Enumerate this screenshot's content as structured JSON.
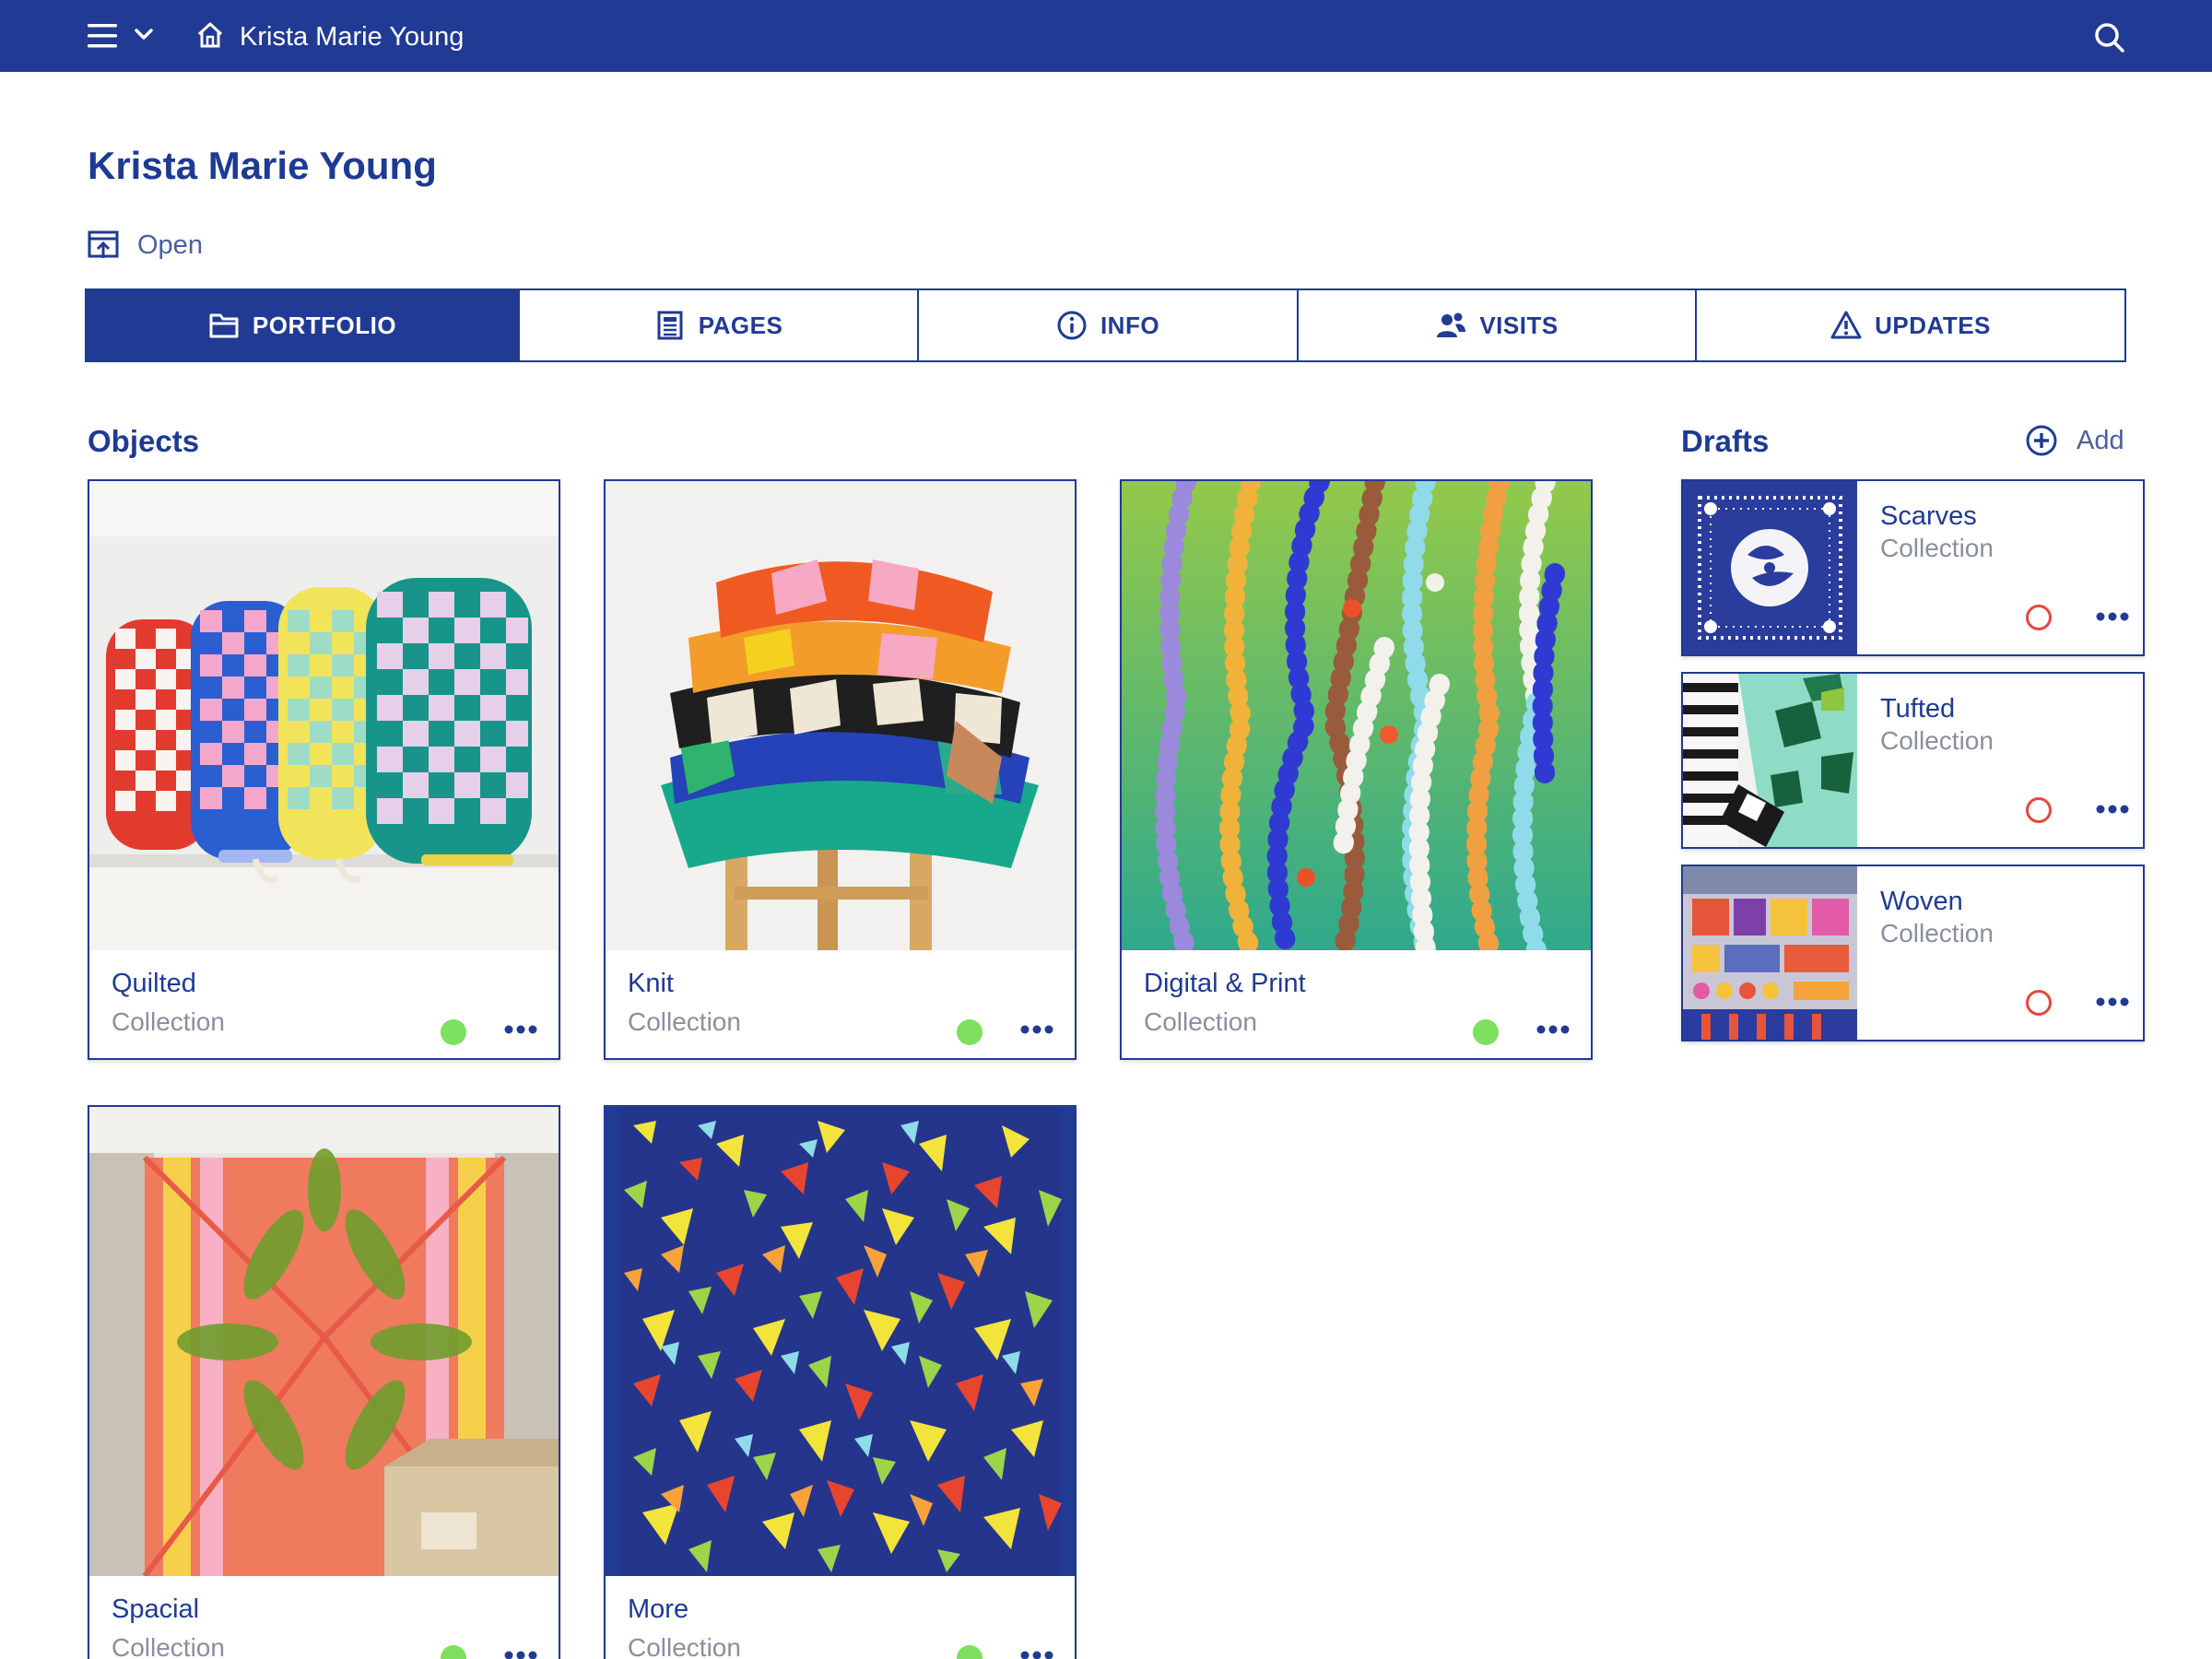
{
  "topbar": {
    "breadcrumb": "Krista Marie Young",
    "icons": [
      "menu-icon",
      "chevron-down-icon",
      "home-icon",
      "search-icon"
    ]
  },
  "header": {
    "title": "Krista Marie Young",
    "open_label": "Open"
  },
  "tabs": [
    {
      "label": "PORTFOLIO",
      "icon": "folder-icon",
      "active": true
    },
    {
      "label": "PAGES",
      "icon": "document-icon",
      "active": false
    },
    {
      "label": "INFO",
      "icon": "info-icon",
      "active": false
    },
    {
      "label": "VISITS",
      "icon": "users-icon",
      "active": false
    },
    {
      "label": "UPDATES",
      "icon": "warning-icon",
      "active": false
    }
  ],
  "objects": {
    "title": "Objects",
    "items": [
      {
        "name": "Quilted",
        "type": "Collection",
        "status": "published"
      },
      {
        "name": "Knit",
        "type": "Collection",
        "status": "published"
      },
      {
        "name": "Digital & Print",
        "type": "Collection",
        "status": "published"
      },
      {
        "name": "Spacial",
        "type": "Collection",
        "status": "published"
      },
      {
        "name": "More",
        "type": "Collection",
        "status": "published"
      }
    ]
  },
  "drafts": {
    "title": "Drafts",
    "add_label": "Add",
    "items": [
      {
        "name": "Scarves",
        "type": "Collection",
        "status": "draft"
      },
      {
        "name": "Tufted",
        "type": "Collection",
        "status": "draft"
      },
      {
        "name": "Woven",
        "type": "Collection",
        "status": "draft"
      }
    ]
  },
  "colors": {
    "brand": "#213a94",
    "published": "#7de05f",
    "draft": "#e8453c",
    "muted": "#8a8f9c"
  }
}
